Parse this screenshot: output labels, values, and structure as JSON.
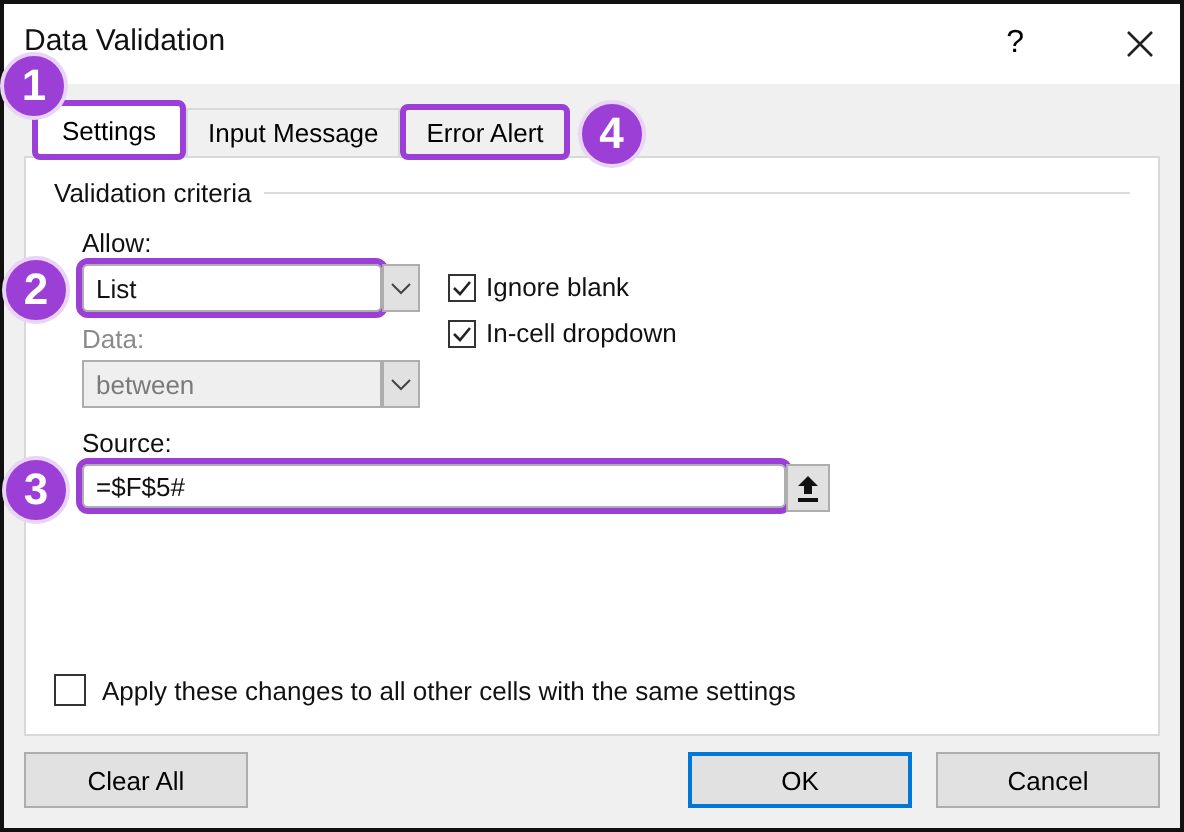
{
  "window": {
    "title": "Data Validation",
    "help": "?"
  },
  "tabs": [
    {
      "label": "Settings",
      "selected": true,
      "highlighted": true,
      "callout": "1"
    },
    {
      "label": "Input Message",
      "selected": false,
      "highlighted": false
    },
    {
      "label": "Error Alert",
      "selected": false,
      "highlighted": true,
      "callout": "4"
    }
  ],
  "group_title": "Validation criteria",
  "allow": {
    "label": "Allow:",
    "value": "List",
    "disabled": false,
    "highlighted": true,
    "callout": "2"
  },
  "data": {
    "label": "Data:",
    "value": "between",
    "disabled": true,
    "highlighted": false
  },
  "checkboxes": [
    {
      "label": "Ignore blank",
      "checked": true
    },
    {
      "label": "In-cell dropdown",
      "checked": true
    }
  ],
  "source": {
    "label": "Source:",
    "value": "=$F$5#",
    "highlighted": true,
    "callout": "3"
  },
  "apply": {
    "label": "Apply these changes to all other cells with the same settings",
    "checked": false
  },
  "buttons": [
    {
      "label": "Clear All",
      "default": false
    },
    {
      "label": "OK",
      "default": true
    },
    {
      "label": "Cancel",
      "default": false
    }
  ]
}
